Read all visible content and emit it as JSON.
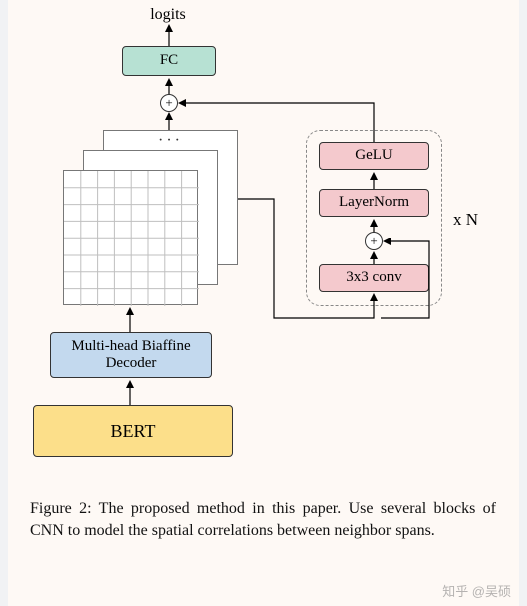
{
  "labels": {
    "logits": "logits",
    "fc": "FC",
    "biaffine": "Multi-head Biaffine\nDecoder",
    "bert": "BERT",
    "conv": "3x3 conv",
    "layernorm": "LayerNorm",
    "gelu": "GeLU",
    "xn": "x N",
    "dots": "···",
    "plus": "+"
  },
  "caption": {
    "prefix": "Figure 2: ",
    "text": "The proposed method in this paper. Use several blocks of CNN to model the spatial correlations between neighbor spans."
  },
  "watermark": "知乎 @吴硕"
}
